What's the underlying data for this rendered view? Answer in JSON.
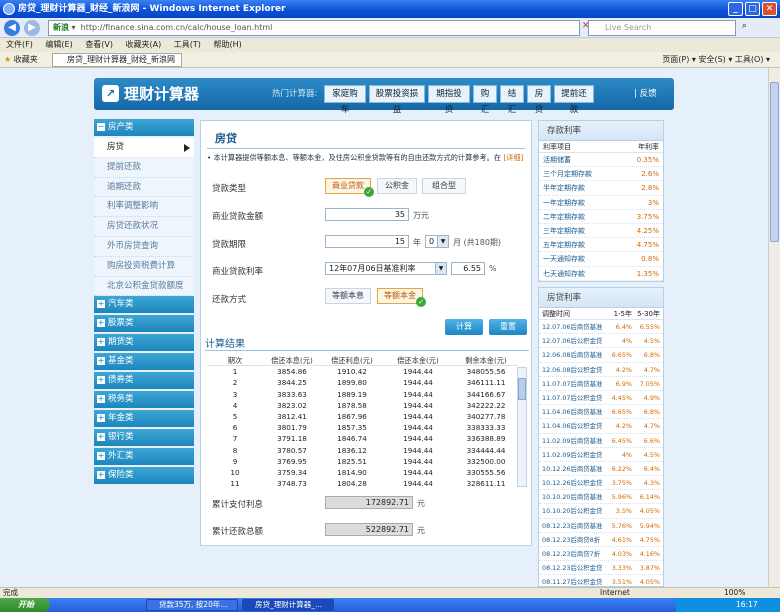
{
  "window": {
    "title": "房贷_理财计算器_财经_新浪网 - Windows Internet Explorer"
  },
  "browser": {
    "address_prefix": "新浪",
    "url": "http://finance.sina.com.cn/calc/house_loan.html",
    "search_placeholder": "Live Search",
    "menu": [
      "文件(F)",
      "编辑(E)",
      "查看(V)",
      "收藏夹(A)",
      "工具(T)",
      "帮助(H)"
    ],
    "favorites_label": "收藏夹",
    "tab_title": "房贷_理财计算器_财经_新浪网",
    "cmd": "页面(P) ▾  安全(S) ▾  工具(O) ▾"
  },
  "header": {
    "logo": "理财计算器",
    "hot_label": "热门计算器:",
    "hot_tabs": [
      "家庭购车",
      "股票投资损益",
      "期指投资",
      "购汇",
      "结汇",
      "房贷",
      "提前还款"
    ],
    "feedback": "| 反馈"
  },
  "sidebar": {
    "sections": [
      {
        "label": "房产类",
        "items": [
          "房贷",
          "提前还款",
          "逾期还款",
          "利率调整影响",
          "房贷还款状况",
          "外币房贷查询",
          "购房投资税费计算",
          "北京公积金贷款额度"
        ]
      },
      {
        "label": "汽车类"
      },
      {
        "label": "股票类"
      },
      {
        "label": "期货类"
      },
      {
        "label": "基金类"
      },
      {
        "label": "债券类"
      },
      {
        "label": "税务类"
      },
      {
        "label": "年金类"
      },
      {
        "label": "银行类"
      },
      {
        "label": "外汇类"
      },
      {
        "label": "保险类"
      }
    ]
  },
  "form": {
    "title": "房贷",
    "desc": "• 本计算器提供等额本息、等额本金，及住房公积金贷款等有的自由还款方式的计算参考。在",
    "desc_more": "[详细]",
    "loan_type_label": "贷款类型",
    "loan_types": [
      "商业贷款",
      "公积金",
      "组合型"
    ],
    "amount_label": "商业贷款金额",
    "amount": "35",
    "amount_unit": "万元",
    "term_label": "贷款期限",
    "term_years": "15",
    "term_years_unit": "年",
    "term_months": "0",
    "term_months_unit": "月 (共180期)",
    "rate_label": "商业贷款利率",
    "rate_select": "12年07月06日基准利率",
    "rate_value": "6.55",
    "rate_unit": "%",
    "repay_label": "还款方式",
    "repay_options": [
      "等额本息",
      "等额本金"
    ],
    "calc_btn": "计算",
    "reset_btn": "重置"
  },
  "results": {
    "title": "计算结果",
    "columns": [
      "期次",
      "偿还本息(元)",
      "偿还利息(元)",
      "偿还本金(元)",
      "剩余本金(元)"
    ],
    "rows": [
      [
        "1",
        "3854.86",
        "1910.42",
        "1944.44",
        "348055.56"
      ],
      [
        "2",
        "3844.25",
        "1899.80",
        "1944.44",
        "346111.11"
      ],
      [
        "3",
        "3833.63",
        "1889.19",
        "1944.44",
        "344166.67"
      ],
      [
        "4",
        "3823.02",
        "1878.58",
        "1944.44",
        "342222.22"
      ],
      [
        "5",
        "3812.41",
        "1867.96",
        "1944.44",
        "340277.78"
      ],
      [
        "6",
        "3801.79",
        "1857.35",
        "1944.44",
        "338333.33"
      ],
      [
        "7",
        "3791.18",
        "1846.74",
        "1944.44",
        "336388.89"
      ],
      [
        "8",
        "3780.57",
        "1836.12",
        "1944.44",
        "334444.44"
      ],
      [
        "9",
        "3769.95",
        "1825.51",
        "1944.44",
        "332500.00"
      ],
      [
        "10",
        "3759.34",
        "1814.90",
        "1944.44",
        "330555.56"
      ],
      [
        "11",
        "3748.73",
        "1804.28",
        "1944.44",
        "328611.11"
      ]
    ],
    "total_interest_label": "累计支付利息",
    "total_interest": "172892.71",
    "total_repay_label": "累计还款总额",
    "total_repay": "522892.71",
    "unit": "元"
  },
  "deposit": {
    "title": "存款利率",
    "col1": "利率项目",
    "col2": "年利率",
    "rows": [
      [
        "活期储蓄",
        "0.35%"
      ],
      [
        "三个月定期存款",
        "2.6%"
      ],
      [
        "半年定期存款",
        "2.8%"
      ],
      [
        "一年定期存款",
        "3%"
      ],
      [
        "二年定期存款",
        "3.75%"
      ],
      [
        "三年定期存款",
        "4.25%"
      ],
      [
        "五年定期存款",
        "4.75%"
      ],
      [
        "一天通知存款",
        "0.8%"
      ],
      [
        "七天通知存款",
        "1.35%"
      ]
    ]
  },
  "loan_rates": {
    "title": "房贷利率",
    "col1": "调整时间",
    "col2": "1-5年",
    "col3": "5-30年",
    "rows": [
      [
        "12.07.06后商贷基准",
        "6.4%",
        "6.55%"
      ],
      [
        "12.07.06后公积金贷",
        "4%",
        "4.5%"
      ],
      [
        "12.06.08后商贷基准",
        "6.65%",
        "6.8%"
      ],
      [
        "12.06.08后公积金贷",
        "4.2%",
        "4.7%"
      ],
      [
        "11.07.07后商贷基准",
        "6.9%",
        "7.05%"
      ],
      [
        "11.07.07后公积金贷",
        "4.45%",
        "4.9%"
      ],
      [
        "11.04.06后商贷基准",
        "6.65%",
        "6.8%"
      ],
      [
        "11.04.06后公积金贷",
        "4.2%",
        "4.7%"
      ],
      [
        "11.02.09后商贷基准",
        "6.45%",
        "6.6%"
      ],
      [
        "11.02.09后公积金贷",
        "4%",
        "4.5%"
      ],
      [
        "10.12.26后商贷基准",
        "6.22%",
        "6.4%"
      ],
      [
        "10.12.26后公积金贷",
        "3.75%",
        "4.3%"
      ],
      [
        "10.10.20后商贷基准",
        "5.96%",
        "6.14%"
      ],
      [
        "10.10.20后公积金贷",
        "3.5%",
        "4.05%"
      ],
      [
        "08.12.23后商贷基准",
        "5.76%",
        "5.94%"
      ],
      [
        "08.12.23后商贷8折",
        "4.61%",
        "4.75%"
      ],
      [
        "08.12.23后商贷7折",
        "4.03%",
        "4.16%"
      ],
      [
        "08.12.23后公积金贷",
        "3.33%",
        "3.87%"
      ],
      [
        "08.11.27后公积金贷",
        "3.51%",
        "4.05%"
      ]
    ]
  },
  "status": {
    "left": "完成",
    "zone": "Internet",
    "zoom": "100%"
  },
  "taskbar": {
    "start": "开始",
    "tasks": [
      "贷款35万, 按20年...",
      "房贷_理财计算器_..."
    ],
    "time": "16:17"
  }
}
